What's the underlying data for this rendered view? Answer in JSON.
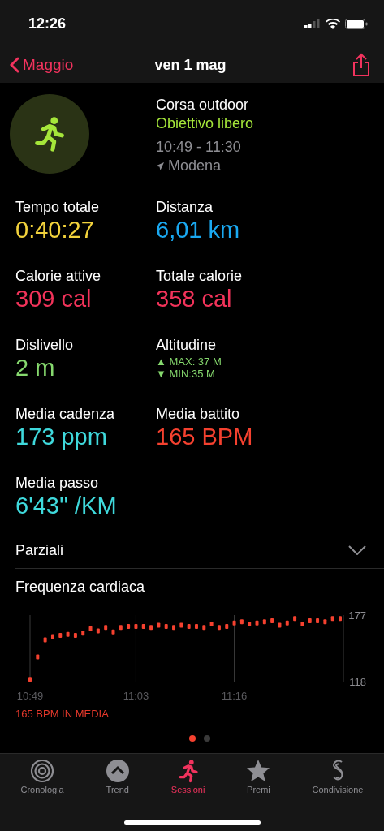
{
  "status_bar": {
    "time": "12:26"
  },
  "nav": {
    "back": "Maggio",
    "title": "ven 1 mag"
  },
  "workout": {
    "name": "Corsa outdoor",
    "goal": "Obiettivo libero",
    "time_range": "10:49 - 11:30",
    "location": "Modena"
  },
  "metrics": [
    [
      {
        "kind": "value",
        "label": "Tempo totale",
        "value": "0:40:27",
        "color": "#f2d23c"
      },
      {
        "kind": "value",
        "label": "Distanza",
        "value": "6,01 km",
        "color": "#1aa8f0"
      }
    ],
    [
      {
        "kind": "value",
        "label": "Calorie attive",
        "value": "309 cal",
        "color": "#f2335a"
      },
      {
        "kind": "value",
        "label": "Totale calorie",
        "value": "358 cal",
        "color": "#f2335a"
      }
    ],
    [
      {
        "kind": "value",
        "label": "Dislivello",
        "value": "2 m",
        "color": "#86d96e"
      },
      {
        "kind": "range",
        "label": "Altitudine",
        "max": "▲ MAX: 37 M",
        "min": "▼ MIN:35 M",
        "color": "#86d96e"
      }
    ],
    [
      {
        "kind": "value",
        "label": "Media cadenza",
        "value": "173 ppm",
        "color": "#3fd9dc"
      },
      {
        "kind": "value",
        "label": "Media battito",
        "value": "165 BPM",
        "color": "#f5412f"
      }
    ],
    [
      {
        "kind": "value",
        "label": "Media passo",
        "value": "6'43'' /KM",
        "color": "#3fd9dc"
      }
    ]
  ],
  "splits": {
    "label": "Parziali",
    "expanded": false
  },
  "heart_rate": {
    "title": "Frequenza cardiaca",
    "average": "165 BPM IN MEDIA",
    "chart_data": {
      "type": "scatter",
      "categories": [
        "10:49",
        null,
        null,
        null,
        null,
        null,
        null,
        null,
        null,
        null,
        null,
        null,
        null,
        null,
        "11:03",
        null,
        null,
        null,
        null,
        null,
        null,
        null,
        null,
        null,
        null,
        null,
        null,
        "11:16",
        null,
        null,
        null,
        null,
        null,
        null,
        null,
        null,
        null,
        null,
        null,
        null,
        null,
        null
      ],
      "series": [
        {
          "color": "#f5412f",
          "values": [
            120,
            140,
            155,
            158,
            159,
            160,
            159,
            161,
            165,
            163,
            166,
            162,
            166,
            167,
            167,
            167,
            166,
            168,
            167,
            166,
            168,
            167,
            167,
            166,
            169,
            166,
            167,
            170,
            171,
            169,
            170,
            171,
            172,
            168,
            170,
            174,
            169,
            172,
            172,
            171,
            174,
            174
          ]
        }
      ],
      "ylim": [
        118,
        177
      ],
      "grid": true,
      "yticks": [
        {
          "value": 118,
          "label": "118"
        },
        {
          "value": 177,
          "label": "177"
        }
      ]
    },
    "pages": [
      {
        "selected": true
      },
      {
        "selected": false
      }
    ]
  },
  "tabs": [
    {
      "label": "Cronologia",
      "kind": "rings",
      "selected": false
    },
    {
      "label": "Trend",
      "kind": "trend",
      "selected": false
    },
    {
      "label": "Sessioni",
      "kind": "runner",
      "selected": true
    },
    {
      "label": "Premi",
      "kind": "star",
      "selected": false
    },
    {
      "label": "Condivisione",
      "kind": "share",
      "selected": false
    }
  ]
}
